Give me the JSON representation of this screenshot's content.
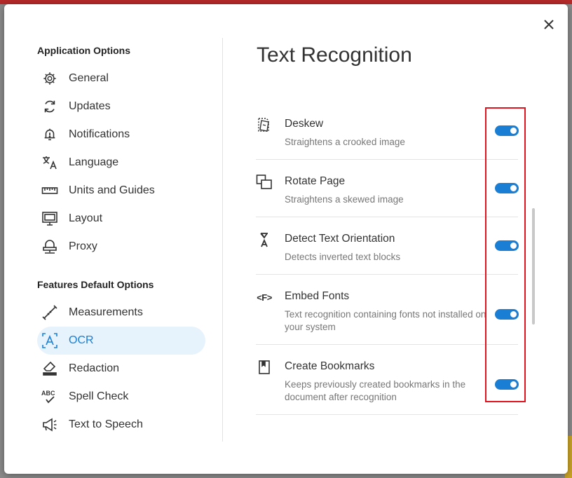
{
  "dialog": {
    "close_label": "✕"
  },
  "sidebar": {
    "sections": [
      {
        "title": "Application Options",
        "items": [
          {
            "label": "General",
            "icon": "gear-icon"
          },
          {
            "label": "Updates",
            "icon": "refresh-icon"
          },
          {
            "label": "Notifications",
            "icon": "bell-alert-icon"
          },
          {
            "label": "Language",
            "icon": "translate-icon"
          },
          {
            "label": "Units and Guides",
            "icon": "ruler-icon"
          },
          {
            "label": "Layout",
            "icon": "layout-icon"
          },
          {
            "label": "Proxy",
            "icon": "proxy-icon"
          }
        ]
      },
      {
        "title": "Features Default Options",
        "items": [
          {
            "label": "Measurements",
            "icon": "measure-icon"
          },
          {
            "label": "OCR",
            "icon": "ocr-icon",
            "active": true
          },
          {
            "label": "Redaction",
            "icon": "eraser-icon"
          },
          {
            "label": "Spell Check",
            "icon": "spell-check-icon"
          },
          {
            "label": "Text to Speech",
            "icon": "megaphone-icon"
          }
        ]
      }
    ]
  },
  "main": {
    "title": "Text Recognition",
    "options": [
      {
        "title": "Deskew",
        "desc": "Straightens a crooked image",
        "icon": "deskew-icon",
        "enabled": true
      },
      {
        "title": "Rotate Page",
        "desc": "Straightens a skewed image",
        "icon": "rotate-page-icon",
        "enabled": true
      },
      {
        "title": "Detect Text Orientation",
        "desc": "Detects inverted text blocks",
        "icon": "text-orientation-icon",
        "enabled": true
      },
      {
        "title": "Embed Fonts",
        "desc": "Text recognition containing fonts not installed on your system",
        "icon": "embed-fonts-icon",
        "glyph": "<F>",
        "enabled": true
      },
      {
        "title": "Create Bookmarks",
        "desc": "Keeps previously created bookmarks in the document after recognition",
        "icon": "bookmark-icon",
        "enabled": true
      }
    ]
  },
  "colors": {
    "accent": "#1a7fd4",
    "active_bg": "#e6f2fc",
    "highlight": "#e0141e"
  }
}
